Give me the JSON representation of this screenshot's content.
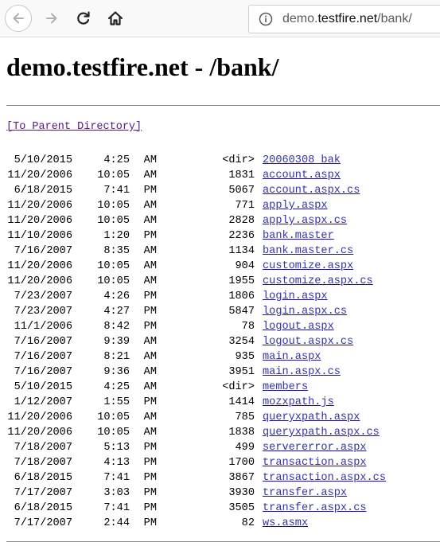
{
  "browser": {
    "url_prefix": "demo.",
    "url_host": "testfire.net",
    "url_path": "/bank/"
  },
  "page": {
    "title": "demo.testfire.net - /bank/",
    "parent_link": "[To Parent Directory]"
  },
  "entries": [
    {
      "date": "5/10/2015",
      "time": "4:25",
      "ampm": "AM",
      "size": "<dir>",
      "name": "20060308_bak"
    },
    {
      "date": "11/20/2006",
      "time": "10:05",
      "ampm": "AM",
      "size": "1831",
      "name": "account.aspx"
    },
    {
      "date": "6/18/2015",
      "time": "7:41",
      "ampm": "PM",
      "size": "5067",
      "name": "account.aspx.cs"
    },
    {
      "date": "11/20/2006",
      "time": "10:05",
      "ampm": "AM",
      "size": "771",
      "name": "apply.aspx"
    },
    {
      "date": "11/20/2006",
      "time": "10:05",
      "ampm": "AM",
      "size": "2828",
      "name": "apply.aspx.cs"
    },
    {
      "date": "11/10/2006",
      "time": "1:20",
      "ampm": "PM",
      "size": "2236",
      "name": "bank.master"
    },
    {
      "date": "7/16/2007",
      "time": "8:35",
      "ampm": "AM",
      "size": "1134",
      "name": "bank.master.cs"
    },
    {
      "date": "11/20/2006",
      "time": "10:05",
      "ampm": "AM",
      "size": "904",
      "name": "customize.aspx"
    },
    {
      "date": "11/20/2006",
      "time": "10:05",
      "ampm": "AM",
      "size": "1955",
      "name": "customize.aspx.cs"
    },
    {
      "date": "7/23/2007",
      "time": "4:26",
      "ampm": "PM",
      "size": "1806",
      "name": "login.aspx"
    },
    {
      "date": "7/23/2007",
      "time": "4:27",
      "ampm": "PM",
      "size": "5847",
      "name": "login.aspx.cs"
    },
    {
      "date": "11/1/2006",
      "time": "8:42",
      "ampm": "PM",
      "size": "78",
      "name": "logout.aspx"
    },
    {
      "date": "7/16/2007",
      "time": "9:39",
      "ampm": "AM",
      "size": "3254",
      "name": "logout.aspx.cs"
    },
    {
      "date": "7/16/2007",
      "time": "8:21",
      "ampm": "AM",
      "size": "935",
      "name": "main.aspx"
    },
    {
      "date": "7/16/2007",
      "time": "9:36",
      "ampm": "AM",
      "size": "3951",
      "name": "main.aspx.cs"
    },
    {
      "date": "5/10/2015",
      "time": "4:25",
      "ampm": "AM",
      "size": "<dir>",
      "name": "members"
    },
    {
      "date": "1/12/2007",
      "time": "1:55",
      "ampm": "PM",
      "size": "1414",
      "name": "mozxpath.js"
    },
    {
      "date": "11/20/2006",
      "time": "10:05",
      "ampm": "AM",
      "size": "785",
      "name": "queryxpath.aspx"
    },
    {
      "date": "11/20/2006",
      "time": "10:05",
      "ampm": "AM",
      "size": "1838",
      "name": "queryxpath.aspx.cs"
    },
    {
      "date": "7/18/2007",
      "time": "5:13",
      "ampm": "PM",
      "size": "499",
      "name": "servererror.aspx"
    },
    {
      "date": "7/18/2007",
      "time": "4:13",
      "ampm": "PM",
      "size": "1700",
      "name": "transaction.aspx"
    },
    {
      "date": "6/18/2015",
      "time": "7:41",
      "ampm": "PM",
      "size": "3867",
      "name": "transaction.aspx.cs"
    },
    {
      "date": "7/17/2007",
      "time": "3:03",
      "ampm": "PM",
      "size": "3930",
      "name": "transfer.aspx"
    },
    {
      "date": "6/18/2015",
      "time": "7:41",
      "ampm": "PM",
      "size": "3505",
      "name": "transfer.aspx.cs"
    },
    {
      "date": "7/17/2007",
      "time": "2:44",
      "ampm": "PM",
      "size": "82",
      "name": "ws.asmx"
    }
  ]
}
